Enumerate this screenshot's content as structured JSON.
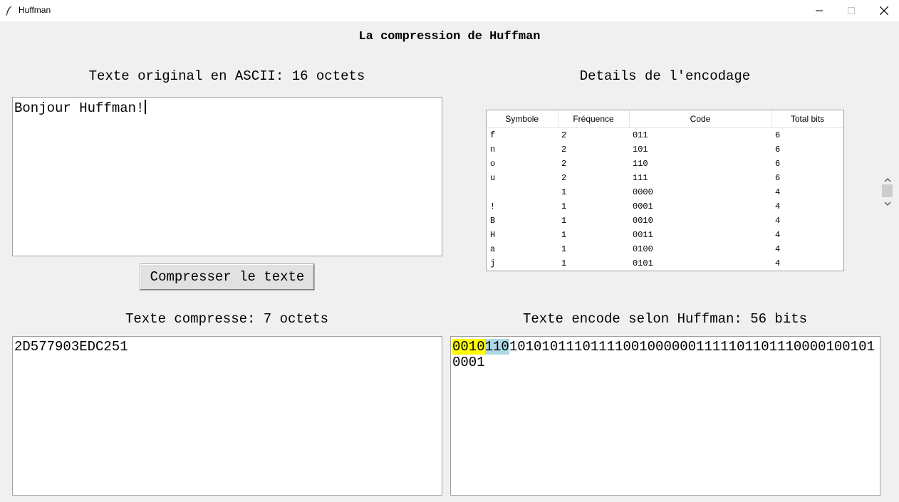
{
  "window": {
    "title": "Huffman",
    "icon": "feather-icon"
  },
  "main_title": "La compression de Huffman",
  "original": {
    "heading": "Texte original en ASCII: 16 octets",
    "text": "Bonjour Huffman!"
  },
  "encoding_details": {
    "heading": "Details de l'encodage",
    "columns": [
      "Symbole",
      "Fréquence",
      "Code",
      "Total bits"
    ],
    "rows": [
      [
        "f",
        "2",
        "011",
        "6"
      ],
      [
        "n",
        "2",
        "101",
        "6"
      ],
      [
        "o",
        "2",
        "110",
        "6"
      ],
      [
        "u",
        "2",
        "111",
        "6"
      ],
      [
        " ",
        "1",
        "0000",
        "4"
      ],
      [
        "!",
        "1",
        "0001",
        "4"
      ],
      [
        "B",
        "1",
        "0010",
        "4"
      ],
      [
        "H",
        "1",
        "0011",
        "4"
      ],
      [
        "a",
        "1",
        "0100",
        "4"
      ],
      [
        "j",
        "1",
        "0101",
        "4"
      ]
    ]
  },
  "compress_button": "Compresser le texte",
  "compressed": {
    "heading": "Texte compresse: 7 octets",
    "text": "2D577903EDC251"
  },
  "encoded": {
    "heading": "Texte encode selon Huffman: 56 bits",
    "highlight_first": "0010",
    "highlight_second": "110",
    "rest": "1010101110111100100000011111011011100001001010001"
  },
  "colors": {
    "highlight_yellow": "#ffff00",
    "highlight_blue": "#add8e6",
    "background": "#f0f0f0"
  }
}
